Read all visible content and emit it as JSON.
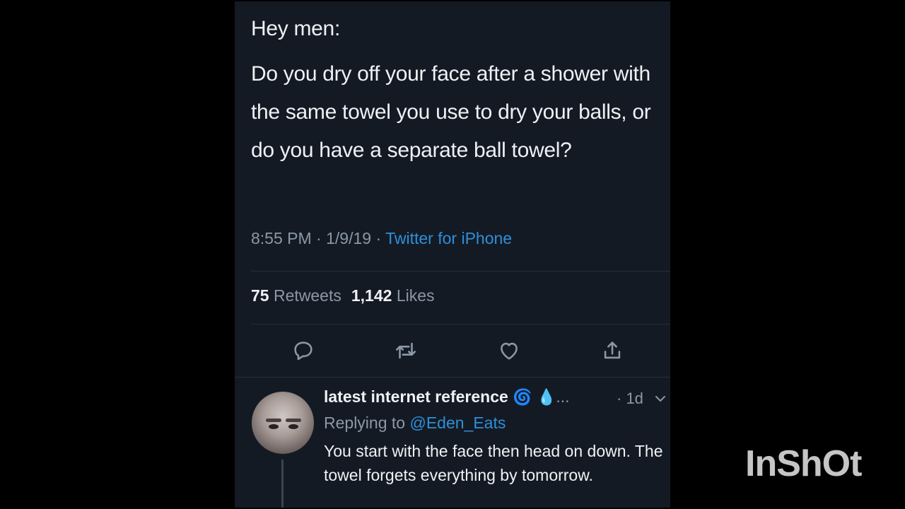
{
  "tweet": {
    "heading": "Hey men:",
    "body": "Do you dry off your face after a shower with the same towel you use to dry your balls, or do you have a separate ball towel?",
    "time": "8:55 PM",
    "date": "1/9/19",
    "sep": "·",
    "source": "Twitter for iPhone",
    "retweets_count": "75",
    "retweets_label": "Retweets",
    "likes_count": "1,142",
    "likes_label": "Likes"
  },
  "actions": [
    {
      "name": "reply-icon"
    },
    {
      "name": "retweet-icon"
    },
    {
      "name": "like-icon"
    },
    {
      "name": "share-icon"
    }
  ],
  "reply": {
    "author": "latest internet reference",
    "emoji_1": "🌀",
    "emoji_2": "💧",
    "ellipsis": "...",
    "time": "· 1d",
    "replying_prefix": "Replying to",
    "replying_handle": "@Eden_Eats",
    "text": "You start with the face then head on down. The towel forgets everything by tomorrow."
  },
  "watermark": "InShOt",
  "colors": {
    "background": "#000000",
    "panel": "#141a24",
    "text": "#eef1f5",
    "muted": "#8b98a6",
    "link": "#2f8fd8"
  }
}
